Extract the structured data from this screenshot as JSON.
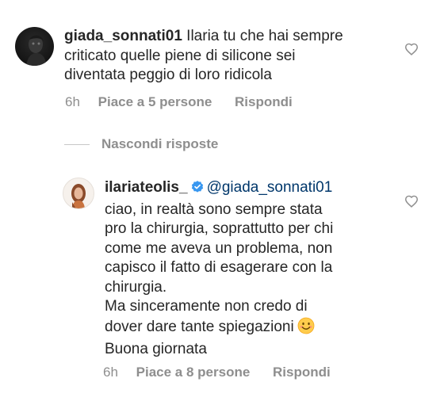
{
  "comment1": {
    "username": "giada_sonnati01",
    "line1": "Ilaria tu che hai sempre",
    "line2": "criticato quelle piene di silicone sei",
    "line3": "diventata peggio di loro ridicola",
    "time": "6h",
    "likes": "Piace a 5 persone",
    "reply": "Rispondi"
  },
  "hide_replies": "Nascondi risposte",
  "comment2": {
    "username": "ilariateolis_",
    "mention": "@giada_sonnati01",
    "lines": [
      "ciao, in realtà sono sempre stata",
      "pro la chirurgia, soprattutto per chi",
      "come me aveva un problema, non",
      "capisco il fatto di esagerare con la",
      "chirurgia.",
      "Ma sinceramente non credo di",
      "dover dare tante spiegazioni",
      "Buona giornata"
    ],
    "time": "6h",
    "likes": "Piace a 8 persone",
    "reply": "Rispondi"
  },
  "icons": [
    "heart-icon",
    "verified-badge-icon",
    "smiling-face-emoji-icon"
  ],
  "colors": {
    "text": "#262626",
    "meta": "#8e8e8e",
    "mention": "#00376b",
    "verified": "#3897f0"
  }
}
